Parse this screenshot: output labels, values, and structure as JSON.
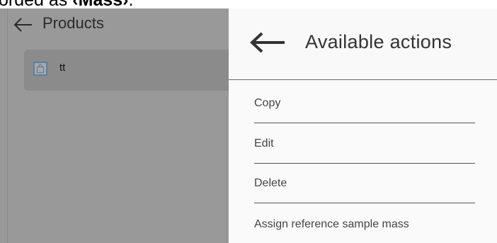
{
  "doc_fragment": {
    "prefix": "orded as ",
    "bold": "‹Mass›",
    "suffix": "."
  },
  "products_panel": {
    "back_icon": "arrow-left-icon",
    "title": "Products",
    "items": [
      {
        "icon": "shopping-bag-icon",
        "name": "tt"
      }
    ]
  },
  "actions_panel": {
    "back_icon": "arrow-left-icon",
    "title": "Available actions",
    "items": [
      {
        "label": "Copy"
      },
      {
        "label": "Edit"
      },
      {
        "label": "Delete"
      },
      {
        "label": "Assign reference sample mass"
      }
    ]
  },
  "colors": {
    "overlay_gray": "#999999",
    "selected_row": "#8b8b8b",
    "panel_bg": "#fafafa",
    "icon_border": "#5a7fa0"
  }
}
